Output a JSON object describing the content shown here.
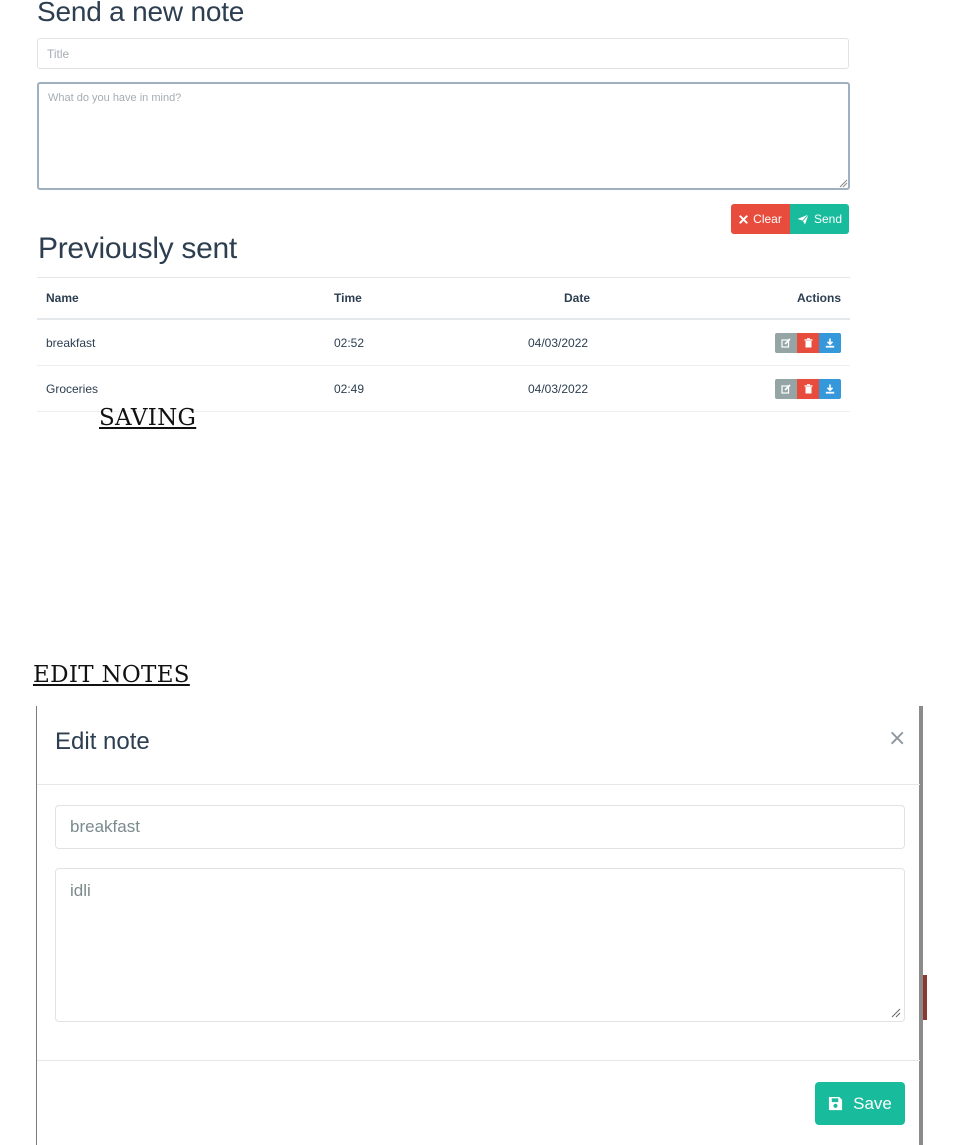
{
  "compose": {
    "heading": "Send a new note",
    "title_placeholder": "Title",
    "body_placeholder": "What do you have in mind?",
    "clear_label": "Clear",
    "send_label": "Send"
  },
  "history": {
    "heading": "Previously sent",
    "columns": {
      "name": "Name",
      "time": "Time",
      "date": "Date",
      "actions": "Actions"
    },
    "rows": [
      {
        "name": "breakfast",
        "time": "02:52",
        "date": "04/03/2022"
      },
      {
        "name": "Groceries",
        "time": "02:49",
        "date": "04/03/2022"
      }
    ]
  },
  "captions": {
    "saving": "SAVING",
    "edit_notes": "EDIT NOTES"
  },
  "modal": {
    "title": "Edit note",
    "close_glyph": "×",
    "title_value": "breakfast",
    "body_value": "idli",
    "save_label": "Save"
  },
  "colors": {
    "danger": "#e74c3c",
    "success": "#18bc9c",
    "info": "#3498db",
    "secondary": "#95a5a6",
    "text": "#2c3e50"
  },
  "icons": {
    "clear": "times-icon",
    "send": "paper-plane-icon",
    "edit": "edit-icon",
    "delete": "trash-icon",
    "download": "download-icon",
    "save": "floppy-disk-icon",
    "close": "close-icon"
  }
}
